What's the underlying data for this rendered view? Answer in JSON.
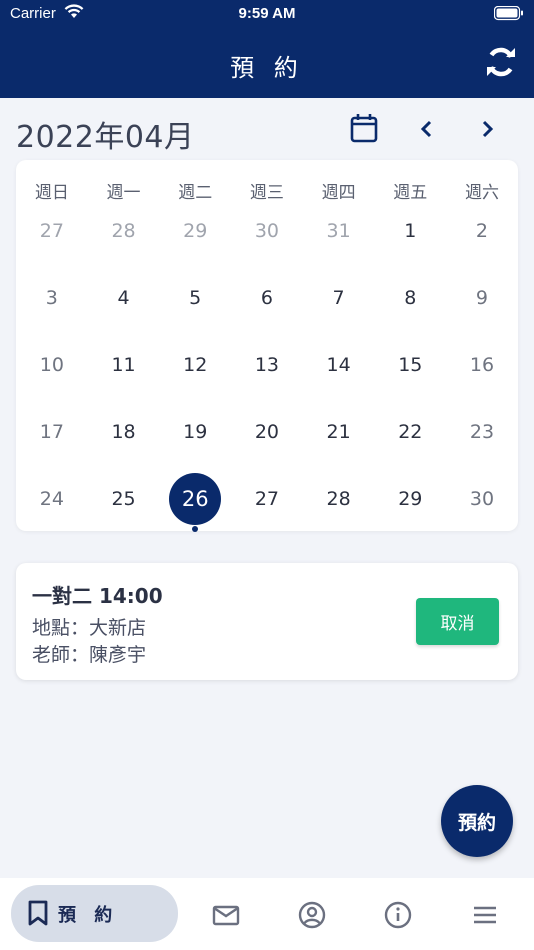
{
  "status_bar": {
    "carrier": "Carrier",
    "time": "9:59 AM"
  },
  "header": {
    "title": "預 約"
  },
  "month_label": "2022年04月",
  "weekdays": [
    "週日",
    "週一",
    "週二",
    "週三",
    "週四",
    "週五",
    "週六"
  ],
  "weeks": [
    [
      {
        "d": "27",
        "s": "muted"
      },
      {
        "d": "28",
        "s": "muted"
      },
      {
        "d": "29",
        "s": "muted"
      },
      {
        "d": "30",
        "s": "muted"
      },
      {
        "d": "31",
        "s": "muted"
      },
      {
        "d": "1",
        "s": ""
      },
      {
        "d": "2",
        "s": "weekend"
      }
    ],
    [
      {
        "d": "3",
        "s": "weekend"
      },
      {
        "d": "4",
        "s": ""
      },
      {
        "d": "5",
        "s": ""
      },
      {
        "d": "6",
        "s": ""
      },
      {
        "d": "7",
        "s": ""
      },
      {
        "d": "8",
        "s": ""
      },
      {
        "d": "9",
        "s": "weekend"
      }
    ],
    [
      {
        "d": "10",
        "s": "weekend"
      },
      {
        "d": "11",
        "s": ""
      },
      {
        "d": "12",
        "s": ""
      },
      {
        "d": "13",
        "s": ""
      },
      {
        "d": "14",
        "s": ""
      },
      {
        "d": "15",
        "s": ""
      },
      {
        "d": "16",
        "s": "weekend"
      }
    ],
    [
      {
        "d": "17",
        "s": "weekend"
      },
      {
        "d": "18",
        "s": ""
      },
      {
        "d": "19",
        "s": ""
      },
      {
        "d": "20",
        "s": ""
      },
      {
        "d": "21",
        "s": ""
      },
      {
        "d": "22",
        "s": ""
      },
      {
        "d": "23",
        "s": "weekend"
      }
    ],
    [
      {
        "d": "24",
        "s": "weekend"
      },
      {
        "d": "25",
        "s": ""
      },
      {
        "d": "26",
        "s": "selected"
      },
      {
        "d": "27",
        "s": ""
      },
      {
        "d": "28",
        "s": ""
      },
      {
        "d": "29",
        "s": ""
      },
      {
        "d": "30",
        "s": "weekend"
      }
    ]
  ],
  "appointment": {
    "title": "一對二 14:00",
    "location": "地點：大新店",
    "teacher": "老師：陳彥宇",
    "cancel_label": "取消"
  },
  "fab_label": "預約",
  "bottom_nav": {
    "active_label": "預 約"
  },
  "colors": {
    "primary": "#0a2a6b",
    "success": "#1fb77d",
    "background": "#f2f4f9",
    "nav_active_bg": "#d7dde8"
  }
}
